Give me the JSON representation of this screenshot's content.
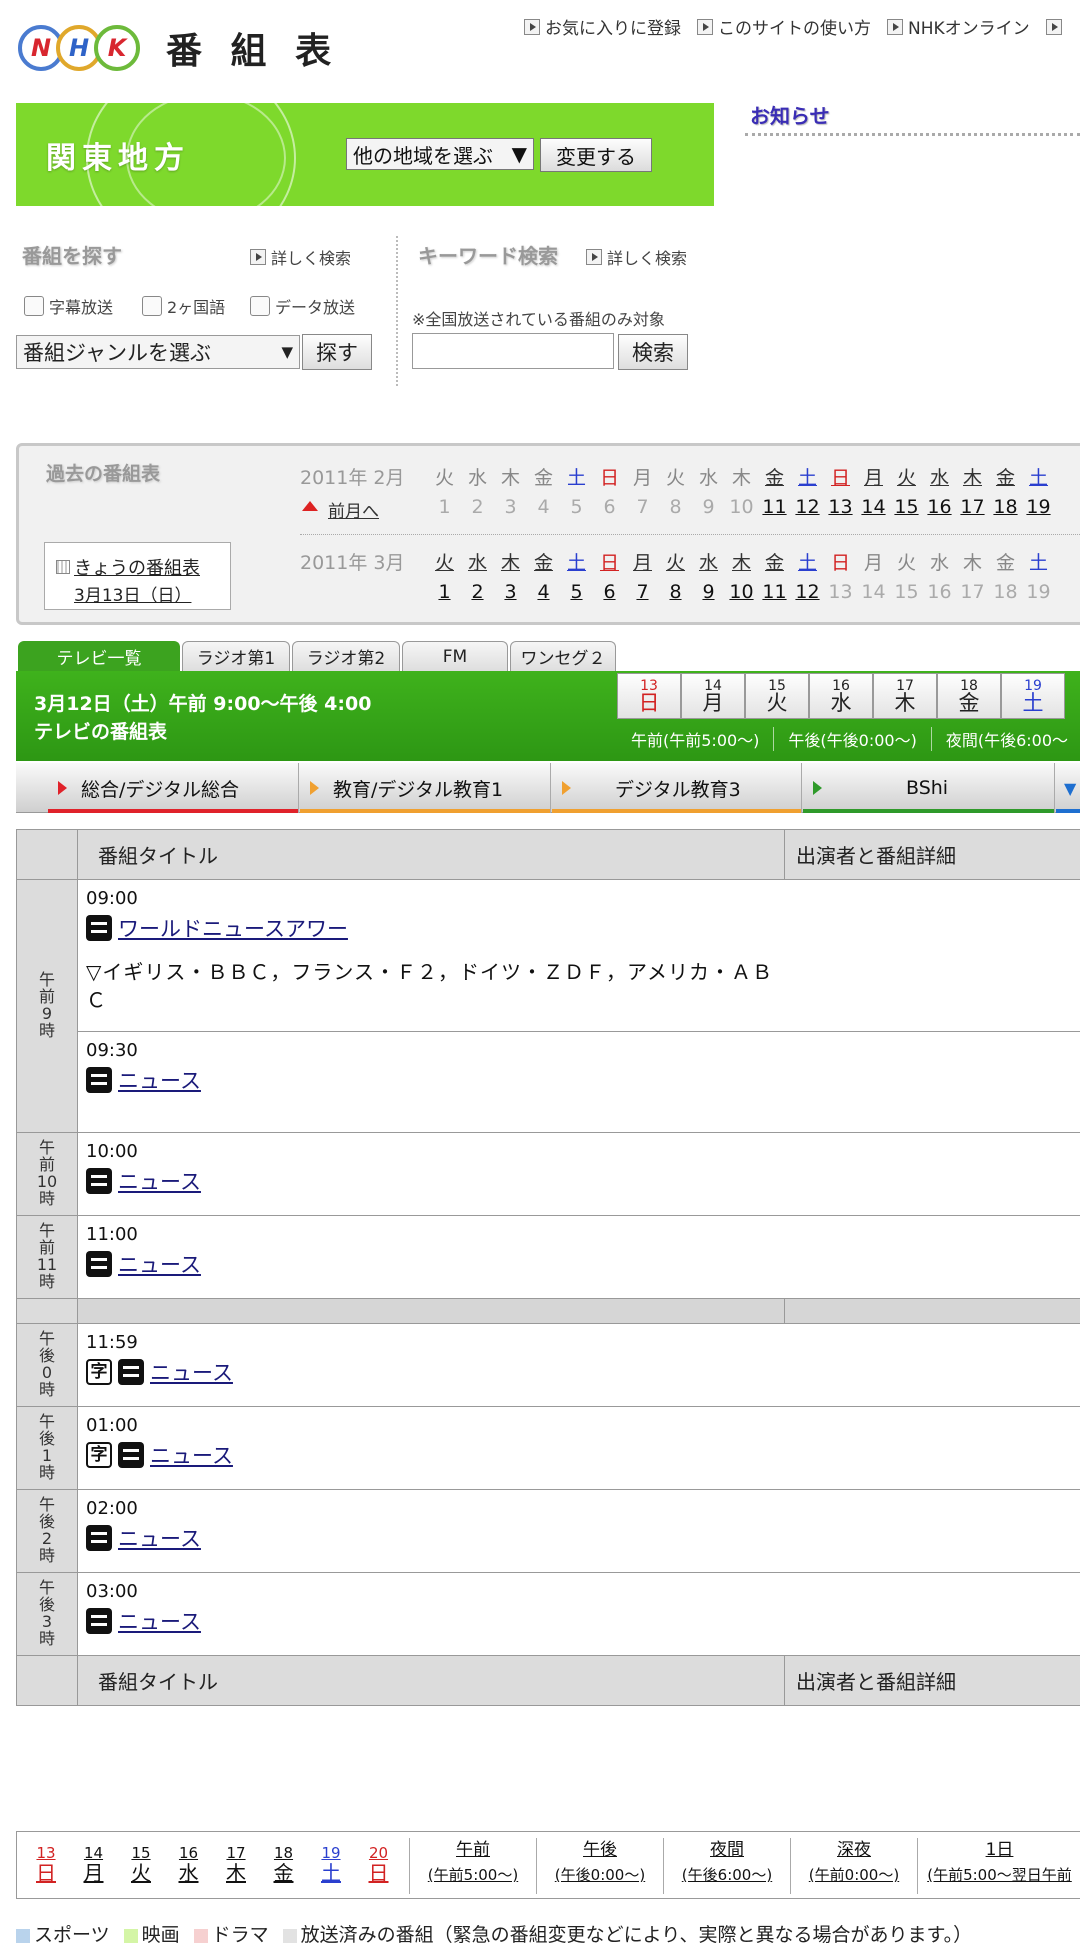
{
  "header": {
    "logo_letters": [
      "N",
      "H",
      "K"
    ],
    "title": "番 組 表",
    "links": [
      "お気に入りに登録",
      "このサイトの使い方",
      "NHKオンライン"
    ]
  },
  "region": {
    "name": "関東地方",
    "select_value": "他の地域を選ぶ",
    "change_button": "変更する"
  },
  "notice": {
    "heading": "お知らせ"
  },
  "program_search": {
    "heading": "番組を探す",
    "detail_link": "詳しく検索",
    "filters": [
      "字幕放送",
      "2ヶ国語",
      "データ放送"
    ],
    "genre_select": "番組ジャンルを選ぶ",
    "search_button": "探す"
  },
  "keyword_search": {
    "heading": "キーワード検索",
    "detail_link": "詳しく検索",
    "note": "※全国放送されている番組のみ対象",
    "input_value": "",
    "search_button": "検索"
  },
  "past": {
    "heading": "過去の番組表",
    "prev_month": "前月へ",
    "today_link": "きょうの番組表",
    "today_date": "3月13日（日）",
    "months": [
      {
        "label": "2011年 2月",
        "weekdays": [
          "火",
          "水",
          "木",
          "金",
          "土",
          "日",
          "月",
          "火",
          "水",
          "木",
          "金",
          "土",
          "日",
          "月",
          "火",
          "水",
          "木",
          "金",
          "土"
        ],
        "days": [
          "1",
          "2",
          "3",
          "4",
          "5",
          "6",
          "7",
          "8",
          "9",
          "10",
          "11",
          "12",
          "13",
          "14",
          "15",
          "16",
          "17",
          "18",
          "19"
        ]
      },
      {
        "label": "2011年 3月",
        "weekdays": [
          "火",
          "水",
          "木",
          "金",
          "土",
          "日",
          "月",
          "火",
          "水",
          "木",
          "金",
          "土",
          "日",
          "月",
          "火",
          "水",
          "木",
          "金",
          "土"
        ],
        "days": [
          "1",
          "2",
          "3",
          "4",
          "5",
          "6",
          "7",
          "8",
          "9",
          "10",
          "11",
          "12",
          "13",
          "14",
          "15",
          "16",
          "17",
          "18",
          "19"
        ]
      }
    ]
  },
  "tabs": [
    "テレビ一覧",
    "ラジオ第1",
    "ラジオ第2",
    "FM",
    "ワンセグ２"
  ],
  "banner": {
    "line1": "3月12日（土）午前 9:00〜午後 4:00",
    "line2": "テレビの番組表",
    "days": [
      {
        "n": "13",
        "w": "日"
      },
      {
        "n": "14",
        "w": "月"
      },
      {
        "n": "15",
        "w": "火"
      },
      {
        "n": "16",
        "w": "水"
      },
      {
        "n": "17",
        "w": "木"
      },
      {
        "n": "18",
        "w": "金"
      },
      {
        "n": "19",
        "w": "土"
      }
    ],
    "periods": [
      "午前(午前5:00〜)",
      "午後(午後0:00〜)",
      "夜間(午後6:00〜"
    ]
  },
  "channels": [
    "総合/デジタル総合",
    "教育/デジタル教育1",
    "デジタル教育3",
    "BShi"
  ],
  "table": {
    "col_title": "番組タイトル",
    "col_detail": "出演者と番組詳細",
    "hours": [
      {
        "label": [
          "午",
          "前",
          "9",
          "時"
        ],
        "programs": [
          {
            "time": "09:00",
            "title": "ワールドニュースアワー",
            "jimaku": false,
            "desc": "▽イギリス・ＢＢＣ，フランス・Ｆ２，ドイツ・ＺＤＦ，アメリカ・ＡＢＣ"
          },
          {
            "time": "09:30",
            "title": "ニュース",
            "jimaku": false,
            "desc": ""
          }
        ]
      },
      {
        "label": [
          "午",
          "前",
          "10",
          "時"
        ],
        "programs": [
          {
            "time": "10:00",
            "title": "ニュース",
            "jimaku": false,
            "desc": ""
          }
        ]
      },
      {
        "label": [
          "午",
          "前",
          "11",
          "時"
        ],
        "programs": [
          {
            "time": "11:00",
            "title": "ニュース",
            "jimaku": false,
            "desc": ""
          }
        ]
      },
      {
        "label": [
          "午",
          "後",
          "0",
          "時"
        ],
        "programs": [
          {
            "time": "11:59",
            "title": "ニュース",
            "jimaku": true,
            "desc": ""
          }
        ]
      },
      {
        "label": [
          "午",
          "後",
          "1",
          "時"
        ],
        "programs": [
          {
            "time": "01:00",
            "title": "ニュース",
            "jimaku": true,
            "desc": ""
          }
        ]
      },
      {
        "label": [
          "午",
          "後",
          "2",
          "時"
        ],
        "programs": [
          {
            "time": "02:00",
            "title": "ニュース",
            "jimaku": false,
            "desc": ""
          }
        ]
      },
      {
        "label": [
          "午",
          "後",
          "3",
          "時"
        ],
        "programs": [
          {
            "time": "03:00",
            "title": "ニュース",
            "jimaku": false,
            "desc": ""
          }
        ]
      }
    ],
    "icon_jimaku": "字"
  },
  "bottom_nav": {
    "days": [
      {
        "n": "13",
        "w": "日"
      },
      {
        "n": "14",
        "w": "月"
      },
      {
        "n": "15",
        "w": "火"
      },
      {
        "n": "16",
        "w": "水"
      },
      {
        "n": "17",
        "w": "木"
      },
      {
        "n": "18",
        "w": "金"
      },
      {
        "n": "19",
        "w": "土"
      },
      {
        "n": "20",
        "w": "日"
      }
    ],
    "periods": [
      {
        "l1": "午前",
        "l2": "(午前5:00〜)"
      },
      {
        "l1": "午後",
        "l2": "(午後0:00〜)"
      },
      {
        "l1": "夜間",
        "l2": "(午後6:00〜)"
      },
      {
        "l1": "深夜",
        "l2": "(午前0:00〜)"
      },
      {
        "l1": "1日",
        "l2": "(午前5:00〜翌日午前"
      }
    ]
  },
  "legend": [
    {
      "label": "スポーツ",
      "color": "#b9d3ec"
    },
    {
      "label": "映画",
      "color": "#d4f5a6"
    },
    {
      "label": "ドラマ",
      "color": "#f6d0d0"
    },
    {
      "label": "放送済みの番組（緊急の番組変更などにより、実際と異なる場合があります。）",
      "color": "#e2e2e2"
    }
  ],
  "colors": {
    "sunday": "#d22222",
    "saturday": "#2a3fcf",
    "green": "#3ca31f",
    "channel_lines": [
      "#e0222a",
      "#f0a030",
      "#f0a030",
      "#2f9a2a"
    ]
  }
}
